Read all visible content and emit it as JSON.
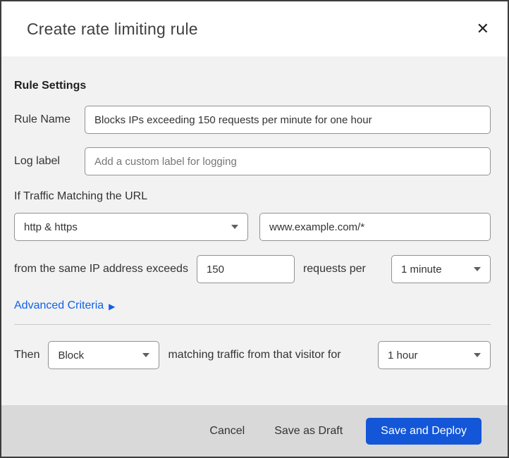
{
  "dialog": {
    "title": "Create rate limiting rule",
    "close_glyph": "✕"
  },
  "rule_settings": {
    "heading": "Rule Settings",
    "rule_name": {
      "label": "Rule Name",
      "value": "Blocks IPs exceeding 150 requests per minute for one hour"
    },
    "log_label": {
      "label": "Log label",
      "placeholder": "Add a custom label for logging"
    }
  },
  "traffic_match": {
    "heading": "If Traffic Matching the URL",
    "scheme_select": {
      "value": "http & https"
    },
    "url_input": {
      "value": "www.example.com/*"
    },
    "threshold": {
      "prefix": "from the same IP address exceeds",
      "requests_value": "150",
      "middle": "requests per",
      "period_select": {
        "value": "1 minute"
      }
    },
    "advanced_link": {
      "label": "Advanced Criteria",
      "arrow": "▶"
    }
  },
  "action": {
    "prefix": "Then",
    "action_select": {
      "value": "Block"
    },
    "middle": "matching traffic from that visitor for",
    "duration_select": {
      "value": "1 hour"
    }
  },
  "footer": {
    "cancel": "Cancel",
    "save_draft": "Save as Draft",
    "save_deploy": "Save and Deploy"
  },
  "colors": {
    "primary_button_blue": "#1356d8",
    "link_blue": "#1161e8",
    "body_background": "#f2f2f2",
    "footer_background": "#d9d9d9",
    "input_border": "#929292",
    "dialog_border": "#3c3c3c"
  }
}
